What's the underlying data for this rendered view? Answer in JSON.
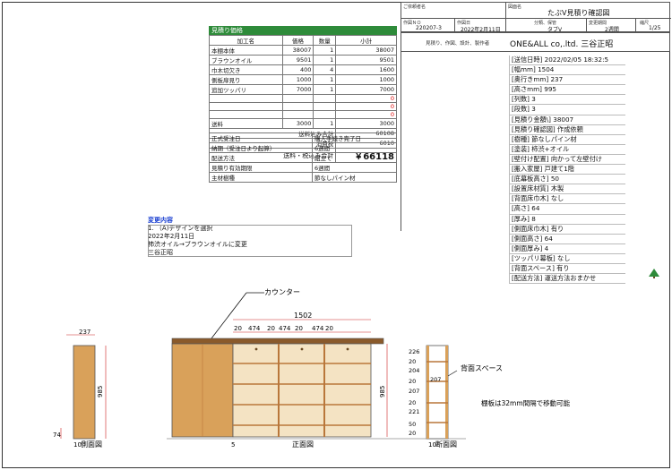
{
  "price_table": {
    "title": "見積り価格",
    "headers": [
      "加工名",
      "価格",
      "数量",
      "小計"
    ],
    "rows": [
      {
        "name": "本棚本体",
        "price": "38007",
        "qty": "1",
        "subtotal": "38007",
        "red": false
      },
      {
        "name": "ブラウンオイル",
        "price": "9501",
        "qty": "1",
        "subtotal": "9501",
        "red": false
      },
      {
        "name": "巾木切欠き",
        "price": "400",
        "qty": "4",
        "subtotal": "1600",
        "red": false
      },
      {
        "name": "側板扉見り",
        "price": "1000",
        "qty": "1",
        "subtotal": "1000",
        "red": false
      },
      {
        "name": "追加ツッパリ",
        "price": "7000",
        "qty": "1",
        "subtotal": "7000",
        "red": false
      },
      {
        "name": "",
        "price": "",
        "qty": "",
        "subtotal": "0",
        "red": true
      },
      {
        "name": "",
        "price": "",
        "qty": "",
        "subtotal": "0",
        "red": true
      },
      {
        "name": "",
        "price": "",
        "qty": "",
        "subtotal": "0",
        "red": true
      },
      {
        "name": "送料",
        "price": "3000",
        "qty": "1",
        "subtotal": "3000",
        "red": false
      }
    ],
    "subtotal_label": "送料込み合計",
    "subtotal_value": "60108",
    "tax_label": "消費税",
    "tax_value": "6010",
    "total_label": "送料・税込み合計",
    "total_value": "￥66118"
  },
  "spec_table": [
    {
      "label": "正式受注日",
      "value": "購入手続き完了日"
    },
    {
      "label": "納期（受注日より起算）",
      "value": "6週間"
    },
    {
      "label": "配送方法",
      "value": "組立て"
    },
    {
      "label": "見積り有効期限",
      "value": "6週間"
    },
    {
      "label": "主材樹種",
      "value": "節なしパイン材"
    }
  ],
  "change": {
    "title": "変更内容",
    "lines": [
      "1. （A)デザインを選択",
      "2022年2月11日",
      "柿渋オイル→ブラウンオイルに変更",
      "三谷正昭"
    ]
  },
  "title_block": {
    "customer_label": "ご依頼者名",
    "drawing_name_label": "図面名",
    "drawing_name": "たぶV見積り確認図",
    "order_no_label": "作図ＮＯ",
    "order_no": "220207-3",
    "date_label": "作図日",
    "date": "2022年2月11日",
    "category_label": "分類、保管",
    "category": "タブV",
    "change_period_label": "変更期間",
    "change_period": "2週間",
    "scale_label": "縮尺",
    "scale": "1/25",
    "maker_label": "見積り、作図、設計、製作者",
    "company": "ONE&ALL co,.ltd. 三谷正昭"
  },
  "info_list": [
    "[送信日時] 2022/02/05 18:32:5",
    "[幅mm] 1504",
    "[奥行きmm] 237",
    "[高さmm] 995",
    "[列数] 3",
    "[段数] 3",
    "[見積り金額\\] 38007",
    "[見積り確認図] 作成依頼",
    "[樹種] 節なしパイン材",
    "[塗装] 柿渋+オイル",
    "[壁付け配置] 向かって左壁付け",
    "[搬入家屋] 戸建て1階",
    "[底幕板高さ] 50",
    "[設置床材質] 木製",
    "[背面床巾木] なし",
    "[高さ] 64",
    "[厚み] 8",
    "[側面床巾木] 有り",
    "[側面高さ] 64",
    "[側面厚み] 4",
    "[ツッパリ幕板] なし",
    "[背面スペース] 有り",
    "[配送方法] 運送方法おまかせ"
  ],
  "drawing": {
    "counter_label": "カウンター",
    "back_space_label": "背面スペース",
    "shelf_note": "棚板は32mm間隔で移動可能",
    "side_view_label": "側面図",
    "front_view_label": "正面図",
    "section_view_label": "断面図",
    "dim_depth": "237",
    "dim_total_width": "1502",
    "dim_total_height": "985",
    "dim_side_height": "985",
    "dim_baseboard": "74",
    "dim_bottom_left": "10",
    "dim_bottom_mid": "5",
    "dim_bottom_right": "10",
    "dim_top_segments": [
      "20",
      "474",
      "20",
      "474",
      "20",
      "474",
      "20"
    ],
    "dim_section_heights": [
      "226",
      "20",
      "204",
      "20",
      "207",
      "20",
      "221",
      "50",
      "20"
    ],
    "dim_section_inner": "207",
    "dim_section_side": [
      "20",
      "20",
      "20",
      "50"
    ]
  },
  "colors": {
    "price_header_bg": "#2e8b3a",
    "change_title": "#1a3fd1",
    "red_value": "#dd0000",
    "wood": "#d9a15a",
    "wood_dark": "#b9773a",
    "dim_red": "#cc2222"
  }
}
